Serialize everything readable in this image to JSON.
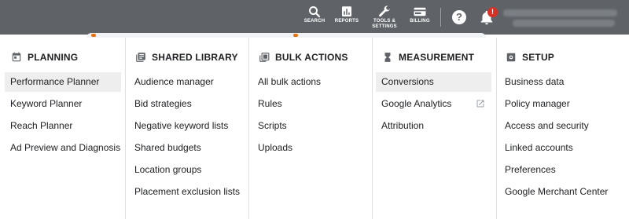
{
  "topbar": {
    "search_label": "SEARCH",
    "reports_label": "REPORTS",
    "tools_label": "TOOLS &\nSETTINGS",
    "billing_label": "BILLING",
    "help_symbol": "?",
    "notification_count": "!",
    "account_name": "",
    "account_email": ""
  },
  "columns": [
    {
      "title": "PLANNING",
      "icon": "calendar-icon",
      "items": [
        "Performance Planner",
        "Keyword Planner",
        "Reach Planner",
        "Ad Preview and Diagnosis"
      ],
      "active_index": 0
    },
    {
      "title": "SHARED LIBRARY",
      "icon": "library-icon",
      "items": [
        "Audience manager",
        "Bid strategies",
        "Negative keyword lists",
        "Shared budgets",
        "Location groups",
        "Placement exclusion lists"
      ]
    },
    {
      "title": "BULK ACTIONS",
      "icon": "copy-icon",
      "items": [
        "All bulk actions",
        "Rules",
        "Scripts",
        "Uploads"
      ]
    },
    {
      "title": "MEASUREMENT",
      "icon": "hourglass-icon",
      "items": [
        "Conversions",
        "Google Analytics",
        "Attribution"
      ],
      "active_index": 0,
      "external_link_index": 1
    },
    {
      "title": "SETUP",
      "icon": "gear-icon",
      "items": [
        "Business data",
        "Policy manager",
        "Access and security",
        "Linked accounts",
        "Preferences",
        "Google Merchant Center"
      ]
    }
  ],
  "colors": {
    "topbar": "#5f6368",
    "active_item": "#eeeeee",
    "badge": "#d93025",
    "icon": "#5f6368"
  }
}
